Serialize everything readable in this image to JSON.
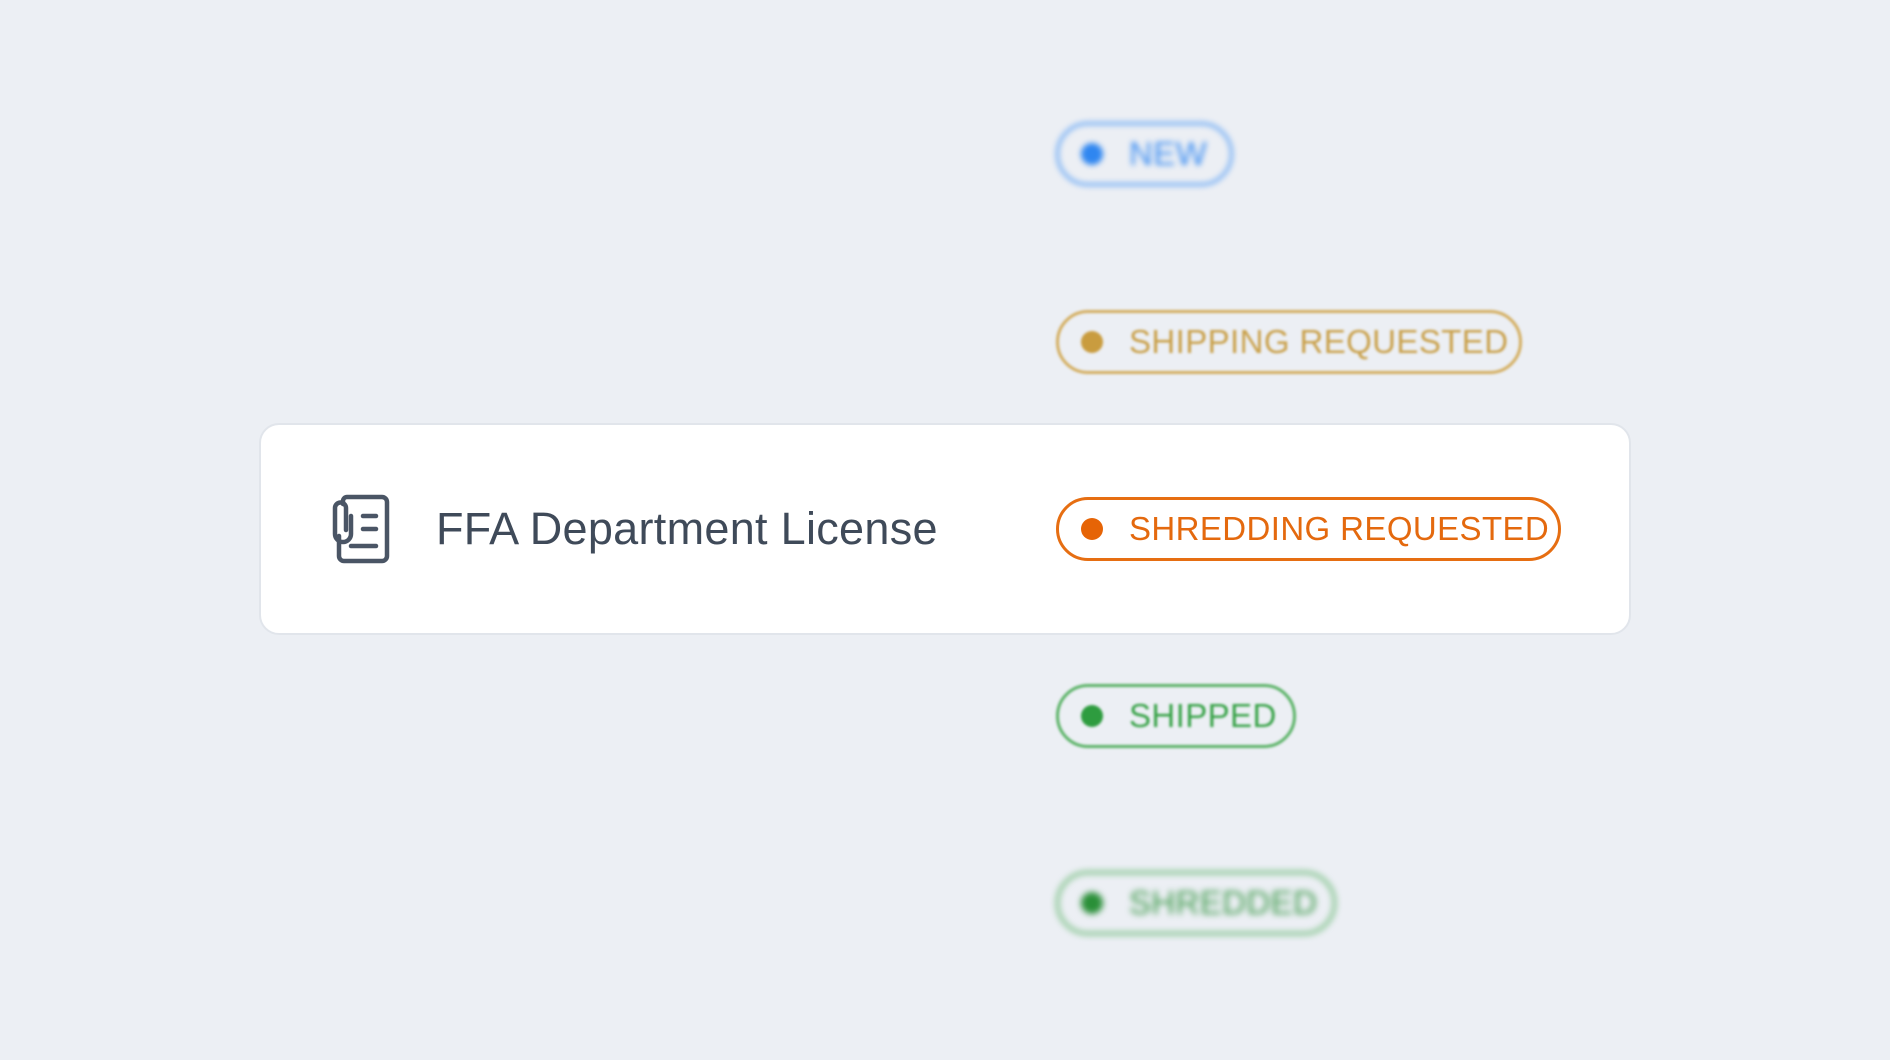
{
  "document": {
    "title": "FFA Department License",
    "icon": "document-with-clip-icon"
  },
  "statuses": [
    {
      "label": "NEW",
      "color": "#2f86f0",
      "focus": "blurred"
    },
    {
      "label": "SHIPPING REQUESTED",
      "color": "#c99c3f",
      "focus": "blurred"
    },
    {
      "label": "SHREDDING REQUESTED",
      "color": "#e66406",
      "focus": "selected"
    },
    {
      "label": "SHIPPED",
      "color": "#2e9c3f",
      "focus": "blurred"
    },
    {
      "label": "SHREDDED",
      "color": "#2a8f38",
      "focus": "blurred"
    }
  ],
  "colors": {
    "background": "#eceff4",
    "card": "#ffffff",
    "title_text": "#3f4a59"
  }
}
